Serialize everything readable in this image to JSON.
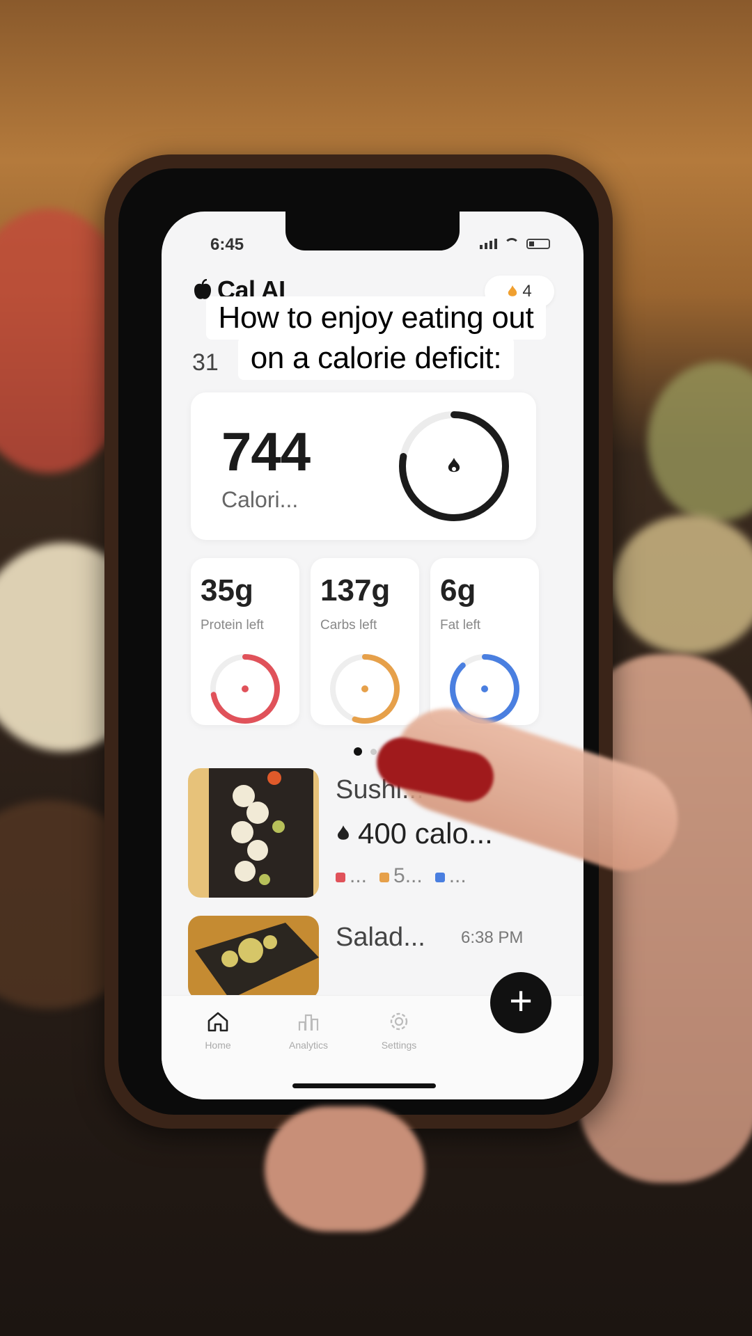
{
  "status_bar": {
    "time": "6:45"
  },
  "app": {
    "name": "Cal AI",
    "streak": "4"
  },
  "date": {
    "day": "31"
  },
  "caption": {
    "line1": "How to enjoy eating out",
    "line2": "on a calorie deficit:"
  },
  "calories": {
    "value": "744",
    "label": "Calori...",
    "ring_progress": 0.78
  },
  "macros": [
    {
      "value": "35g",
      "label": "Protein left",
      "color": "#e0525a",
      "progress": 0.72
    },
    {
      "value": "137g",
      "label": "Carbs left",
      "color": "#e6a04a",
      "progress": 0.55
    },
    {
      "value": "6g",
      "label": "Fat left",
      "color": "#4a7fe0",
      "progress": 0.88
    }
  ],
  "foods": [
    {
      "title": "Sushi...",
      "kcal": "400 calo...",
      "m1": "...",
      "m2": "5...",
      "m3": "..."
    },
    {
      "title": "Salad...",
      "time": "6:38 PM"
    }
  ],
  "nav": {
    "home": "Home",
    "analytics": "Analytics",
    "settings": "Settings",
    "add": "+"
  },
  "colors": {
    "accent": "#111111",
    "protein": "#e0525a",
    "carbs": "#e6a04a",
    "fat": "#4a7fe0"
  }
}
